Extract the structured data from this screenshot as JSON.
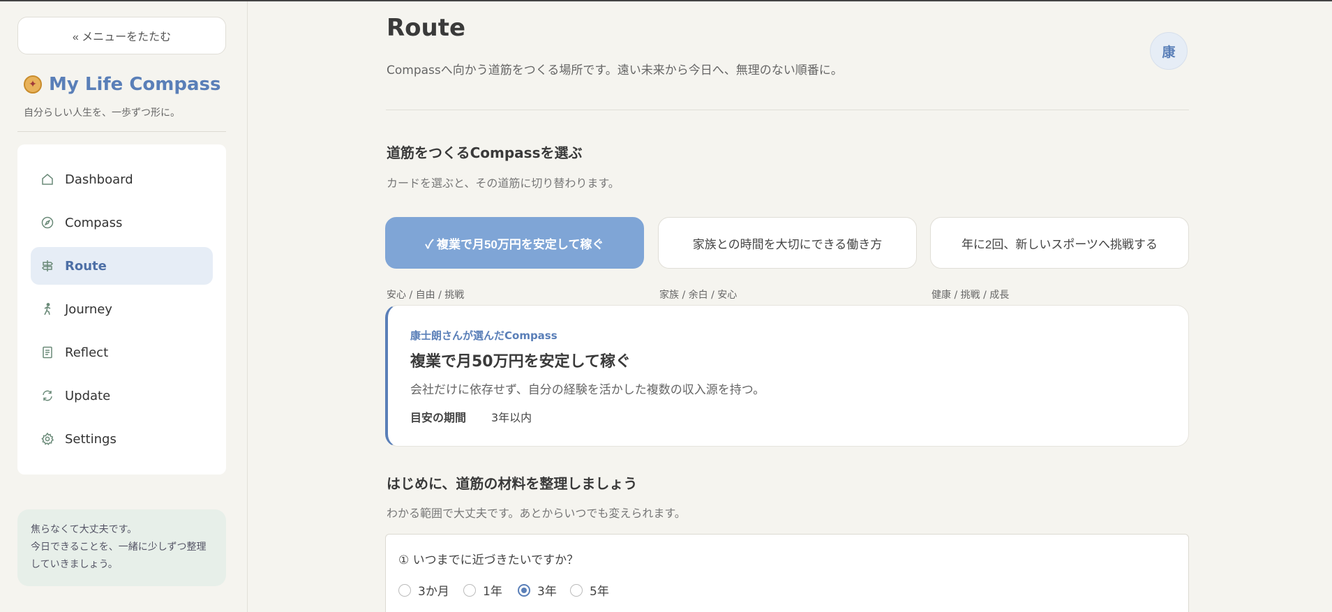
{
  "sidebar": {
    "collapse_label": "« メニューをたたむ",
    "brand_title": "My Life Compass",
    "brand_subtitle": "自分らしい人生を、一歩ずつ形に。",
    "items": [
      {
        "label": "Dashboard",
        "icon": "home-icon"
      },
      {
        "label": "Compass",
        "icon": "compass-icon"
      },
      {
        "label": "Route",
        "icon": "signpost-icon",
        "active": true
      },
      {
        "label": "Journey",
        "icon": "walking-icon"
      },
      {
        "label": "Reflect",
        "icon": "notebook-icon"
      },
      {
        "label": "Update",
        "icon": "refresh-icon"
      },
      {
        "label": "Settings",
        "icon": "gear-icon"
      }
    ],
    "tip_line1": "焦らなくて大丈夫です。",
    "tip_line2": "今日できることを、一緒に少しずつ整理していきましょう。"
  },
  "header": {
    "title": "Route",
    "description": "Compassへ向かう道筋をつくる場所です。遠い未来から今日へ、無理のない順番に。",
    "avatar_initial": "康"
  },
  "compass_select": {
    "title": "道筋をつくるCompassを選ぶ",
    "description": "カードを選ぶと、その道筋に切り替わります。",
    "choices": [
      {
        "label": "✓ 複業で月50万円を安定して稼ぐ",
        "tags": "安心 / 自由 / 挑戦",
        "selected": true
      },
      {
        "label": "家族との時間を大切にできる働き方",
        "tags": "家族 / 余白 / 安心",
        "selected": false
      },
      {
        "label": "年に2回、新しいスポーツへ挑戦する",
        "tags": "健康 / 挑戦 / 成長",
        "selected": false
      }
    ]
  },
  "detail": {
    "owner_label": "康士朗さんが選んだCompass",
    "title": "複業で月50万円を安定して稼ぐ",
    "description": "会社だけに依存せず、自分の経験を活かした複数の収入源を持つ。",
    "period_label": "目安の期間",
    "period_value": "3年以内"
  },
  "materials": {
    "title": "はじめに、道筋の材料を整理しましょう",
    "description": "わかる範囲で大丈夫です。あとからいつでも変えられます。",
    "question1": {
      "label": "① いつまでに近づきたいですか？",
      "options": [
        "3か月",
        "1年",
        "3年",
        "5年"
      ],
      "selected": "3年"
    }
  },
  "colors": {
    "accent": "#5a7fb8",
    "selected_card": "#7fa5d6",
    "active_nav_bg": "#e6edf6",
    "tip_bg": "#e7efe9",
    "page_bg": "#f5f4ef"
  }
}
